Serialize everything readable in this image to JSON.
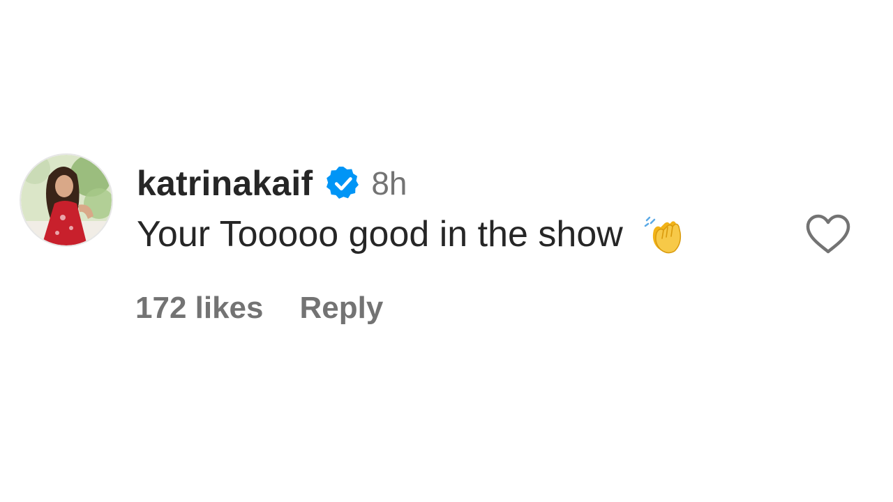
{
  "comment": {
    "username": "katrinakaif",
    "verified_icon": "verified-badge-icon",
    "time": "8h",
    "text": "Your Tooooo good in the show",
    "emoji_icon": "clapping-hands-emoji",
    "likes": "172 likes",
    "reply_label": "Reply",
    "like_icon": "heart-outline-icon"
  },
  "colors": {
    "text_primary": "#262626",
    "text_secondary": "#737373",
    "verified_blue": "#0095f6",
    "heart_outline": "#737373"
  }
}
